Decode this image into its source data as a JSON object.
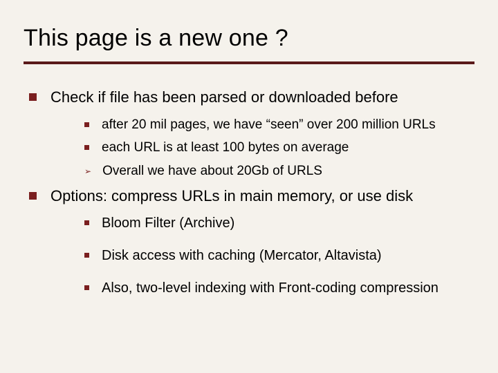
{
  "title": "This page is a new one ?",
  "points": [
    {
      "text": "Check if file has been parsed or downloaded before",
      "sub": [
        {
          "bullet": "square",
          "text": "after 20 mil pages, we have “seen” over 200 million URLs"
        },
        {
          "bullet": "square",
          "text": "each URL is at least 100 bytes on average"
        },
        {
          "bullet": "arrow",
          "text": "Overall we have about 20Gb of URLS"
        }
      ]
    },
    {
      "text": "Options:  compress URLs in main memory, or use disk",
      "sub": [
        {
          "bullet": "square",
          "text": "Bloom Filter (Archive)"
        },
        {
          "bullet": "square",
          "text": "Disk access with caching  (Mercator, Altavista)"
        },
        {
          "bullet": "square",
          "text": "Also, two-level indexing with Front-coding compression"
        }
      ]
    }
  ]
}
